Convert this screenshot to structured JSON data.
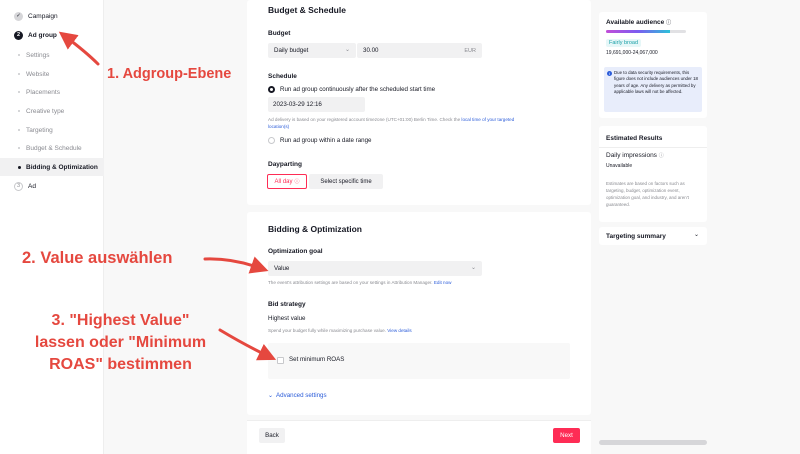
{
  "sidebar": {
    "steps": [
      {
        "label": "Campaign",
        "badge": "✓"
      },
      {
        "label": "Ad group",
        "badge": "2"
      },
      {
        "label": "Ad",
        "badge": "3"
      }
    ],
    "sub_items": [
      "Settings",
      "Website",
      "Placements",
      "Creative type",
      "Targeting",
      "Budget & Schedule",
      "Bidding & Optimization"
    ],
    "active_sub": "Bidding & Optimization"
  },
  "budget": {
    "title": "Budget & Schedule",
    "budget_label": "Budget",
    "budget_type": "Daily budget",
    "budget_value": "30.00",
    "currency": "EUR",
    "schedule_label": "Schedule",
    "option_continuous": "Run ad group continuously after the scheduled start time",
    "start_datetime": "2023-03-29 12:16",
    "timezone_hint_1": "Ad delivery is based on your registered account timezone (UTC+01:00) Berlin Time. Check the",
    "timezone_link": "local time of your targeted",
    "timezone_link_2": "location(s)",
    "option_range": "Run ad group within a date range",
    "dayparting_label": "Dayparting",
    "dayparting_all": "All day",
    "dayparting_specific": "Select specific time"
  },
  "bidding": {
    "title": "Bidding & Optimization",
    "goal_label": "Optimization goal",
    "goal_value": "Value",
    "goal_hint": "The event's attribution settings are based on your settings in Attribution Manager.",
    "goal_hint_link": "Edit now",
    "strategy_label": "Bid strategy",
    "strategy_value": "Highest value",
    "strategy_hint": "Spend your budget fully while maximizing purchase value.",
    "strategy_hint_link": "View details",
    "roas_label": "Set minimum ROAS",
    "advanced_label": "Advanced settings"
  },
  "footer": {
    "back_label": "Back",
    "next_label": "Next"
  },
  "audience": {
    "title": "Available audience",
    "breadth": "Fairly broad",
    "range": "19,691,000-24,067,000",
    "meter_level": 0.8,
    "notice": "Due to data security requirements, this figure does not include audiences under 18 years of age. Any delivery as permitted by applicable laws will not be affected."
  },
  "estimated": {
    "title": "Estimated Results",
    "impressions_label": "Daily impressions",
    "impressions_value": "Unavailable",
    "note": "Estimates are based on factors such as targeting, budget, optimization event, optimization goal, and industry, and aren't guaranteed."
  },
  "targeting_summary": {
    "title": "Targeting summary"
  },
  "annotations": {
    "a1": "1. Adgroup-Ebene",
    "a2": "2. Value auswählen",
    "a3_l1": "3. \"Highest Value\"",
    "a3_l2": "lassen oder \"Minimum",
    "a3_l3": "ROAS\" bestimmen"
  },
  "colors": {
    "accent": "#fe2c55",
    "annotation": "#e5483f",
    "link": "#2b5cd9",
    "badge_text": "#1aa0a7"
  }
}
